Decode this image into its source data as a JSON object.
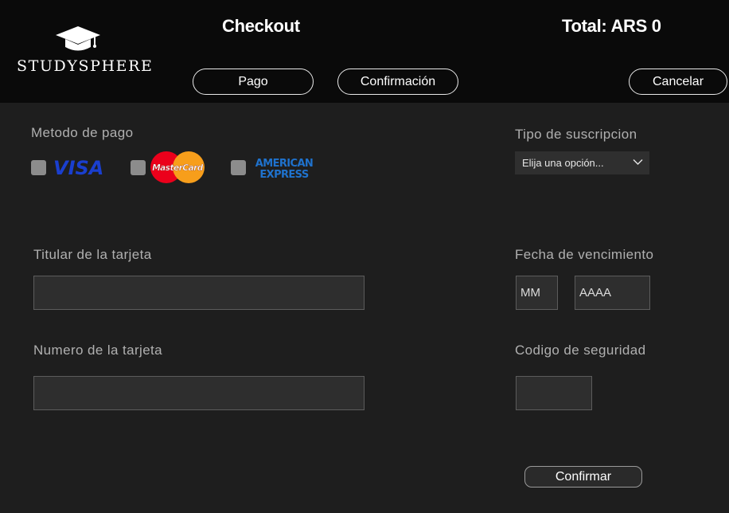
{
  "header": {
    "logo_text": "STUDYSPHERE",
    "title": "Checkout",
    "total": "Total: ARS 0",
    "tabs": [
      {
        "label": "Pago"
      },
      {
        "label": "Confirmación"
      }
    ],
    "cancel_label": "Cancelar"
  },
  "payment": {
    "method_label": "Metodo de pago",
    "methods": [
      {
        "name": "VISA",
        "icon": "visa-logo",
        "checked": false
      },
      {
        "name": "MasterCard",
        "icon": "mastercard-logo",
        "checked": false
      },
      {
        "name": "AMERICAN EXPRESS",
        "line1": "AMERICAN",
        "line2": "EXPRESS",
        "icon": "amex-logo",
        "checked": false
      }
    ]
  },
  "subscription": {
    "label": "Tipo de suscripcion",
    "selected": "Elija una opción..."
  },
  "card": {
    "holder_label": "Titular de la tarjeta",
    "holder_value": "",
    "number_label": "Numero de la tarjeta",
    "number_value": "",
    "expiry_label": "Fecha de vencimiento",
    "month_placeholder": "MM",
    "year_placeholder": "AAAA",
    "cvv_label": "Codigo de seguridad",
    "cvv_value": ""
  },
  "confirm_label": "Confirmar",
  "colors": {
    "header_bg": "#0a0a0a",
    "page_bg": "#1e1e1e",
    "input_bg": "#2e2e2e",
    "visa_blue": "#1a3fcf",
    "mc_red": "#eb001b",
    "mc_orange": "#f79e1b",
    "amex_blue": "#1f72cd"
  }
}
